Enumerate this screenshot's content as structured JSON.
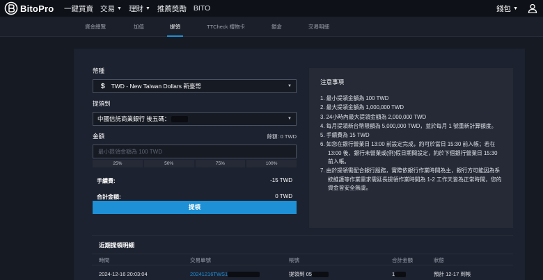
{
  "brand": {
    "name": "BitoPro",
    "accent": "#1d90d6"
  },
  "topnav": {
    "items": [
      {
        "label": "一鍵買賣",
        "dropdown": false
      },
      {
        "label": "交易",
        "dropdown": true
      },
      {
        "label": "理財",
        "dropdown": true
      },
      {
        "label": "推薦獎勵",
        "dropdown": false
      },
      {
        "label": "BITO",
        "dropdown": false
      }
    ],
    "wallet_label": "錢包",
    "user_icon": "user-icon"
  },
  "subnav": {
    "tabs": [
      {
        "label": "資金總覽",
        "active": false
      },
      {
        "label": "加值",
        "active": false
      },
      {
        "label": "提領",
        "active": true
      },
      {
        "label": "TTCheck 禮物卡",
        "active": false
      },
      {
        "label": "鎖倉",
        "active": false
      },
      {
        "label": "交易明細",
        "active": false
      }
    ]
  },
  "form": {
    "currency_label": "幣種",
    "currency_symbol": "$",
    "currency_value": "TWD - New Taiwan Dollars 新臺幣",
    "dest_label": "提領到",
    "dest_value": "中國信託商業銀行 後五碼：",
    "amount_label": "金額",
    "balance": "餘額: 0 TWD",
    "amount_placeholder": "最小提領金額為 100 TWD",
    "percentages": [
      "25%",
      "50%",
      "75%",
      "100%"
    ],
    "fee_label": "手續費:",
    "fee_value": "-15 TWD",
    "total_label": "合計金額:",
    "total_value": "0 TWD",
    "submit_label": "提領"
  },
  "notes": {
    "title": "注意事項",
    "items": [
      "1. 最小提領金額為 100 TWD",
      "2. 最大提領金額為 1,000,000 TWD",
      "3. 24小時內最大提領金額為 2,000,000 TWD",
      "4. 每月提領新台幣限額為 5,000,000 TWD，並於每月 1 號重新計算額度。",
      "5. 手續費為 15 TWD",
      "6. 如您在銀行營業日 13:00 前設定完成，約可於當日 15:30 前入帳；若在 13:00 後、銀行未營業或(例)假日期間設定，約於下個銀行營業日 15:30 前入帳。",
      "7. 由於提領需配合銀行服務，實際依銀行作業時間為主，銀行方可能因為系統維護等作業需求需延長提領作業時間為 1-2 工作天皆為正常時間，您的資金皆安全無虞。"
    ]
  },
  "history": {
    "title": "近期提領明細",
    "columns": [
      "時間",
      "交易單號",
      "帳號",
      "合計金額",
      "狀態"
    ],
    "rows": [
      {
        "time": "2024-12-16 20:03:04",
        "order": "20241216TWS1",
        "account": "提領到 05",
        "total": "1",
        "status": "預計 12-17 到帳"
      }
    ]
  }
}
